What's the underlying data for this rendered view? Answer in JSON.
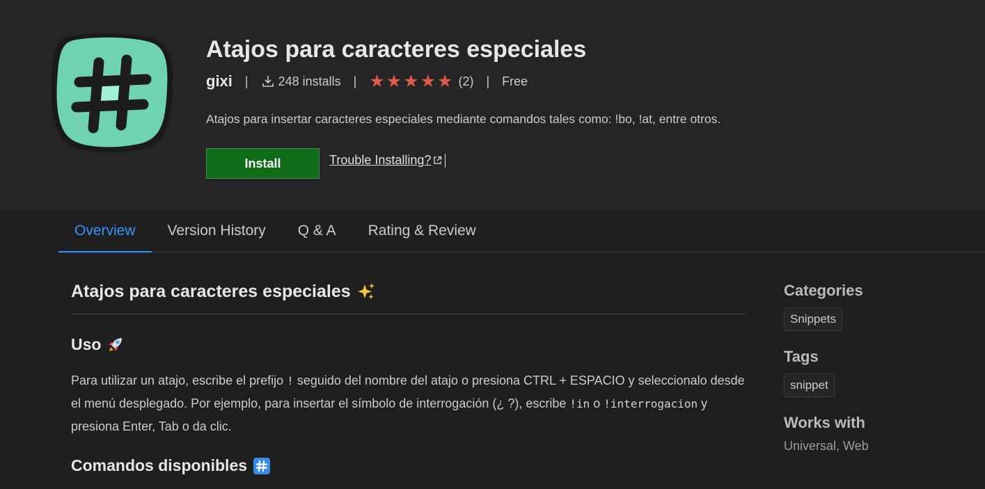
{
  "extension": {
    "title": "Atajos para caracteres especiales",
    "publisher": "gixi",
    "installs": "248 installs",
    "rating": 5,
    "rating_count": "(2)",
    "price": "Free",
    "description": "Atajos para insertar caracteres especiales mediante comandos tales como: !bo, !at, entre otros.",
    "install_label": "Install",
    "trouble_label": "Trouble Installing?",
    "icon": "hash-icon"
  },
  "colors": {
    "accent": "#3794ff",
    "install_bg": "#0e6b18",
    "star": "#e05a4a",
    "icon_bg": "#6fd3b0"
  },
  "tabs": [
    {
      "label": "Overview",
      "active": true
    },
    {
      "label": "Version History",
      "active": false
    },
    {
      "label": "Q & A",
      "active": false
    },
    {
      "label": "Rating & Review",
      "active": false
    }
  ],
  "readme": {
    "heading": "Atajos para caracteres especiales",
    "heading_emoji": "sparkles-icon",
    "uso_heading": "Uso",
    "uso_emoji": "rocket-icon",
    "para_part1": "Para utilizar un atajo, escribe el prefijo ",
    "code_prefix": "!",
    "para_part2": " seguido del nombre del atajo o presiona CTRL + ESPACIO y seleccionalo desde el menú desplegado. Por ejemplo, para insertar el símbolo de interrogación (¿ ?), escribe ",
    "code_in": "!in",
    "para_part3": " o ",
    "code_interrogacion": "!interrogacion",
    "para_part4": " y presiona Enter, Tab o da clic.",
    "comandos_heading": "Comandos disponibles",
    "comandos_emoji": "hash-keycap-icon"
  },
  "sidebar": {
    "categories_heading": "Categories",
    "categories": [
      "Snippets"
    ],
    "tags_heading": "Tags",
    "tags": [
      "snippet"
    ],
    "works_with_heading": "Works with",
    "works_with": "Universal, Web"
  }
}
